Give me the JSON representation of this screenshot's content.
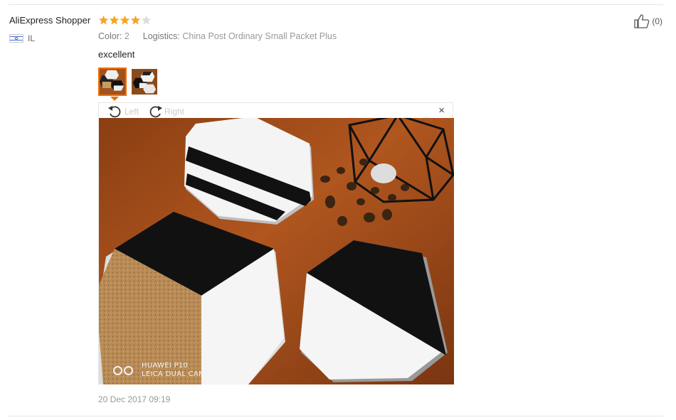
{
  "review": {
    "username": "AliExpress Shopper",
    "rating": 4,
    "max_rating": 5,
    "country_code": "IL",
    "attributes": [
      {
        "key": "Color:",
        "value": "2"
      },
      {
        "key": "Logistics:",
        "value": "China Post Ordinary Small Packet Plus"
      }
    ],
    "feedback_text": "excellent",
    "helpful_count": "(0)",
    "date": "20 Dec 2017 09:19"
  },
  "viewer": {
    "rotate_left_label": "Left",
    "rotate_right_label": "Right",
    "close_label": "×",
    "watermark_line1": "HUAWEI P10",
    "watermark_line2": "LEICA DUAL CAMERA"
  },
  "icons": {
    "star": "star-icon",
    "thumbs_up": "thumbs-up-icon",
    "rotate_left": "rotate-left-icon",
    "rotate_right": "rotate-right-icon",
    "close": "close-icon",
    "flag": "israel-flag-icon"
  },
  "colors": {
    "star_filled": "#f5a623",
    "star_empty": "#dddddd",
    "accent": "#f36d00"
  }
}
